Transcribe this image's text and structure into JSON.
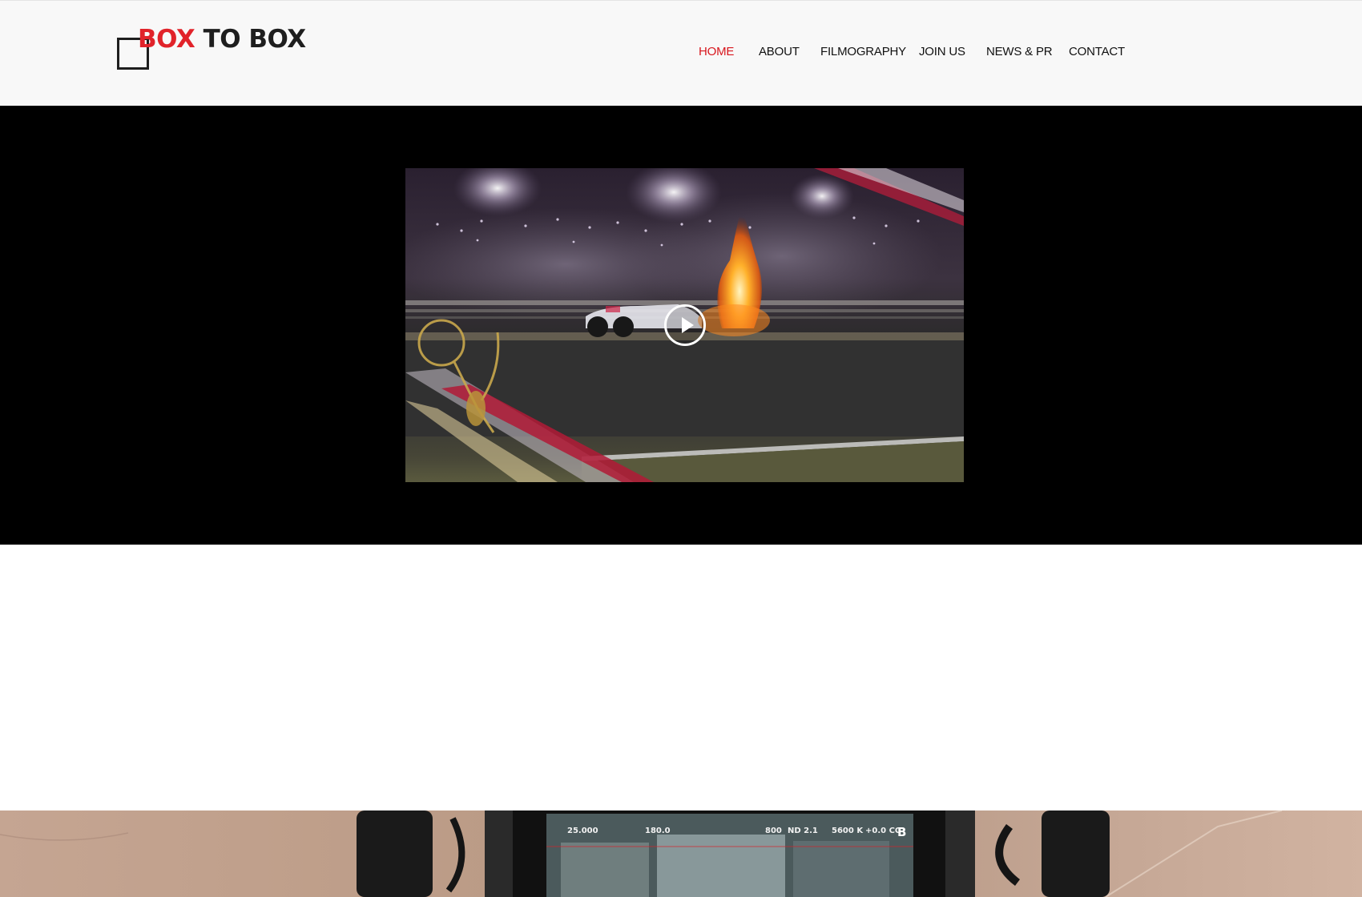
{
  "brand": {
    "name_part1": "BOX",
    "name_part2": " TO BOX",
    "accent_color": "#e1232a"
  },
  "nav": {
    "items": [
      {
        "label": "HOME",
        "active": true
      },
      {
        "label": "ABOUT",
        "active": false
      },
      {
        "label": "FILMOGRAPHY",
        "active": false
      },
      {
        "label": "JOIN US",
        "active": false
      },
      {
        "label": "NEWS & PR",
        "active": false
      },
      {
        "label": "CONTACT",
        "active": false
      }
    ],
    "active_color": "#d8171e"
  },
  "video": {
    "play_icon": "play-circle-icon"
  },
  "monitor": {
    "fps": "25.000",
    "shutter": "180.0",
    "iso": "800",
    "nd": "ND 2.1",
    "wb": "5600 K",
    "cc": "+0.0 CC",
    "camera_letter": "B"
  }
}
